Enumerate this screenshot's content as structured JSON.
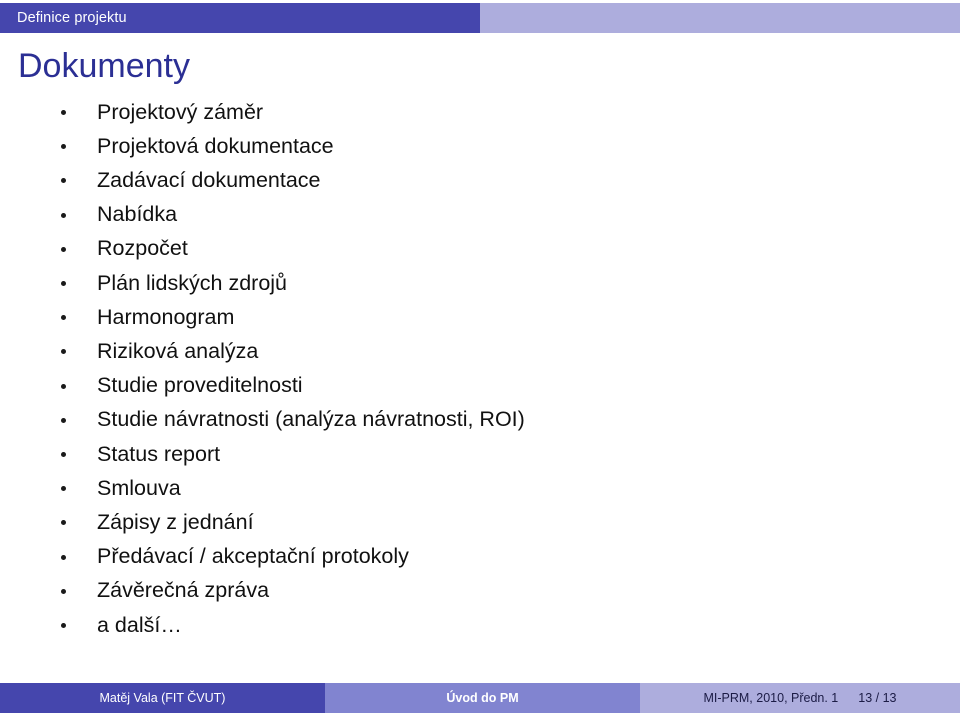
{
  "header": {
    "section_title": "Definice projektu"
  },
  "slide": {
    "heading": "Dokumenty",
    "bullets": [
      {
        "label": "Projektový záměr"
      },
      {
        "label": "Projektová dokumentace"
      },
      {
        "label": "Zadávací dokumentace"
      },
      {
        "label": "Nabídka"
      },
      {
        "label": "Rozpočet"
      },
      {
        "label": "Plán lidských zdrojů"
      },
      {
        "label": "Harmonogram"
      },
      {
        "label": "Riziková analýza"
      },
      {
        "label": "Studie proveditelnosti"
      },
      {
        "label": "Studie návratnosti (analýza návratnosti, ROI)"
      },
      {
        "label": "Status report"
      },
      {
        "label": "Smlouva"
      },
      {
        "label": "Zápisy z jednání"
      },
      {
        "label": "Předávací / akceptační protokoly"
      },
      {
        "label": "Závěrečná zpráva"
      },
      {
        "label": "a další…"
      }
    ]
  },
  "footer": {
    "author": "Matěj Vala (FIT ČVUT)",
    "course": "Úvod do PM",
    "lecture_ref": "MI-PRM, 2010, Předn. 1",
    "page_number": "13 / 13"
  },
  "colors": {
    "header_dark": "#4546ad",
    "header_light": "#adaddd",
    "footer_mid": "#8184d0",
    "heading_text": "#2b2f94",
    "body_text": "#111111"
  }
}
